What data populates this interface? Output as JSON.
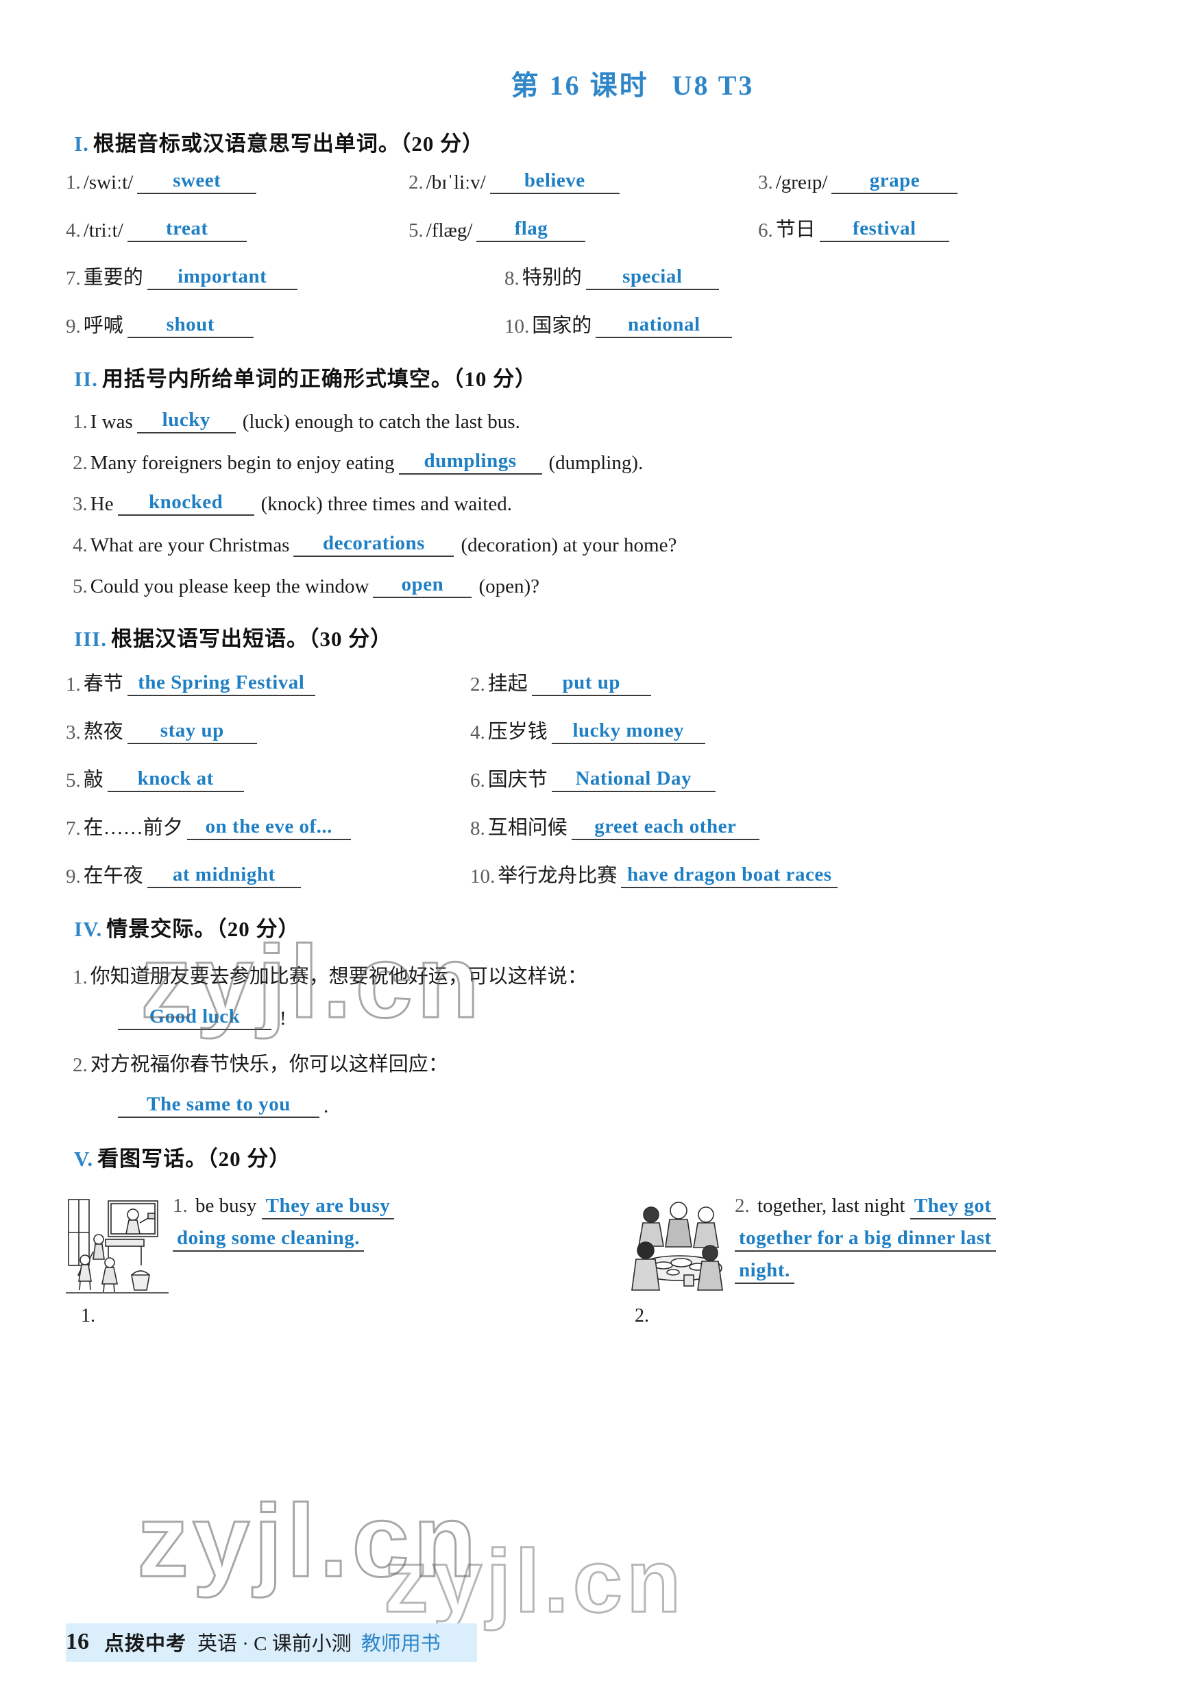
{
  "title": {
    "prefix": "第 16 课时",
    "unit": "U8  T3"
  },
  "sections": {
    "one": {
      "num": "I.",
      "heading": "根据音标或汉语意思写出单词。（20 分）",
      "items": [
        {
          "n": "1.",
          "prompt": "/swiːt/",
          "answer": "sweet"
        },
        {
          "n": "2.",
          "prompt": "/bɪˈliːv/",
          "answer": "believe"
        },
        {
          "n": "3.",
          "prompt": "/greɪp/",
          "answer": "grape"
        },
        {
          "n": "4.",
          "prompt": "/triːt/",
          "answer": "treat"
        },
        {
          "n": "5.",
          "prompt": "/flæg/",
          "answer": "flag"
        },
        {
          "n": "6.",
          "prompt": "节日",
          "answer": "festival"
        },
        {
          "n": "7.",
          "prompt": "重要的",
          "answer": "important"
        },
        {
          "n": "8.",
          "prompt": "特别的",
          "answer": "special"
        },
        {
          "n": "9.",
          "prompt": "呼喊",
          "answer": "shout"
        },
        {
          "n": "10.",
          "prompt": "国家的",
          "answer": "national"
        }
      ]
    },
    "two": {
      "num": "II.",
      "heading": "用括号内所给单词的正确形式填空。（10 分）",
      "items": [
        {
          "n": "1.",
          "before": "I was",
          "answer": "lucky",
          "after": "(luck) enough to catch the last bus."
        },
        {
          "n": "2.",
          "before": "Many foreigners begin to enjoy eating",
          "answer": "dumplings",
          "after": "(dumpling)."
        },
        {
          "n": "3.",
          "before": "He",
          "answer": "knocked",
          "after": "(knock) three times and waited."
        },
        {
          "n": "4.",
          "before": "What are your Christmas",
          "answer": "decorations",
          "after": "(decoration) at your home?"
        },
        {
          "n": "5.",
          "before": "Could you please keep the window",
          "answer": "open",
          "after": "(open)?"
        }
      ]
    },
    "three": {
      "num": "III.",
      "heading": "根据汉语写出短语。（30 分）",
      "items": [
        {
          "n": "1.",
          "prompt": "春节",
          "answer": "the Spring Festival"
        },
        {
          "n": "2.",
          "prompt": "挂起",
          "answer": "put up"
        },
        {
          "n": "3.",
          "prompt": "熬夜",
          "answer": "stay up"
        },
        {
          "n": "4.",
          "prompt": "压岁钱",
          "answer": "lucky money"
        },
        {
          "n": "5.",
          "prompt": "敲",
          "answer": "knock at"
        },
        {
          "n": "6.",
          "prompt": "国庆节",
          "answer": "National Day"
        },
        {
          "n": "7.",
          "prompt": "在……前夕",
          "answer": "on the eve of..."
        },
        {
          "n": "8.",
          "prompt": "互相问候",
          "answer": "greet each other"
        },
        {
          "n": "9.",
          "prompt": "在午夜",
          "answer": "at midnight"
        },
        {
          "n": "10.",
          "prompt": "举行龙舟比赛",
          "answer": "have dragon boat races"
        }
      ]
    },
    "four": {
      "num": "IV.",
      "heading": "情景交际。（20 分）",
      "items": [
        {
          "n": "1.",
          "prompt": "你知道朋友要去参加比赛，想要祝他好运，可以这样说：",
          "answer": "Good luck",
          "tail": "!"
        },
        {
          "n": "2.",
          "prompt": "对方祝福你春节快乐，你可以这样回应：",
          "answer": "The same to you",
          "tail": "."
        }
      ]
    },
    "five": {
      "num": "V.",
      "heading": "看图写话。（20 分）",
      "items": [
        {
          "n": "1.",
          "cue": "be busy",
          "answer_line1": "They are busy",
          "answer_line2": "doing some cleaning.",
          "caption": "1.",
          "picture": "classroom-cleaning-illustration"
        },
        {
          "n": "2.",
          "cue": "together, last night",
          "answer_line1": "They got",
          "answer_line2": "together for a big dinner last",
          "answer_line3": "night.",
          "caption": "2.",
          "picture": "family-dinner-illustration"
        }
      ]
    }
  },
  "watermark": {
    "text": "zyjl.cn"
  },
  "footer": {
    "page": "16",
    "brand": "点拨中考",
    "middle": "英语 · C 课前小测",
    "end": "教师用书"
  },
  "colors": {
    "answer_blue": "#1f7fc4",
    "title_blue": "#2e86c8",
    "footer_band": "#daeefc"
  }
}
